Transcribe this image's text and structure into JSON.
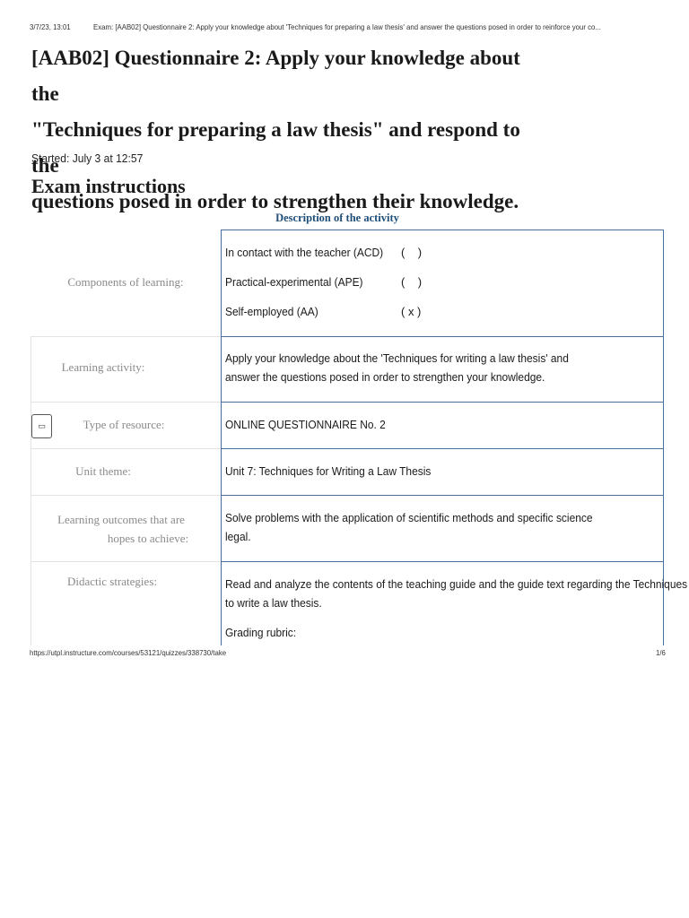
{
  "print_header": {
    "datetime": "3/7/23, 13:01",
    "page_title": "Exam: [AAB02] Questionnaire 2: Apply your knowledge about 'Techniques for preparing a law thesis' and answer the questions posed in order to reinforce your co..."
  },
  "exam": {
    "title_line1": "[AAB02] Questionnaire 2: Apply your knowledge about the",
    "title_line2": "\"Techniques for preparing a law thesis\" and respond to the",
    "title_line3": "questions posed in order to strengthen their knowledge.",
    "started": "Started: July 3 at 12:57",
    "instructions_heading": "Exam instructions"
  },
  "activity_table": {
    "caption": "Description of the activity",
    "components": {
      "label": "Components of learning:",
      "options": [
        {
          "name": "In contact with the teacher (ACD)",
          "mark": "(    )"
        },
        {
          "name": "Practical-experimental (APE)",
          "mark": "(    )"
        },
        {
          "name": "Self-employed (AA)",
          "mark": "( x )"
        }
      ]
    },
    "learning_activity": {
      "label": "Learning activity:",
      "line1": "Apply your knowledge about the 'Techniques for writing a law thesis' and",
      "line2": "answer the questions posed in order to strengthen your knowledge."
    },
    "resource_type": {
      "label": "Type of resource:",
      "value": "ONLINE QUESTIONNAIRE No. 2",
      "toggle_glyph": "▭"
    },
    "unit_theme": {
      "label": "Unit theme:",
      "value": "Unit 7: Techniques for Writing a Law Thesis"
    },
    "outcomes": {
      "label_line1": "Learning outcomes that are",
      "label_line2": "hopes to achieve:",
      "line1": "Solve problems with the application of scientific methods and specific science",
      "line2": "legal."
    },
    "strategies": {
      "label": "Didactic strategies:",
      "line1": "Read and analyze the contents of the teaching guide and the guide text regarding the Techniques",
      "line2": "to write a law thesis.",
      "line3": "Grading rubric:"
    }
  },
  "print_footer": {
    "url": "https://utpl.instructure.com/courses/53121/quizzes/338730/take",
    "page": "1/6"
  }
}
